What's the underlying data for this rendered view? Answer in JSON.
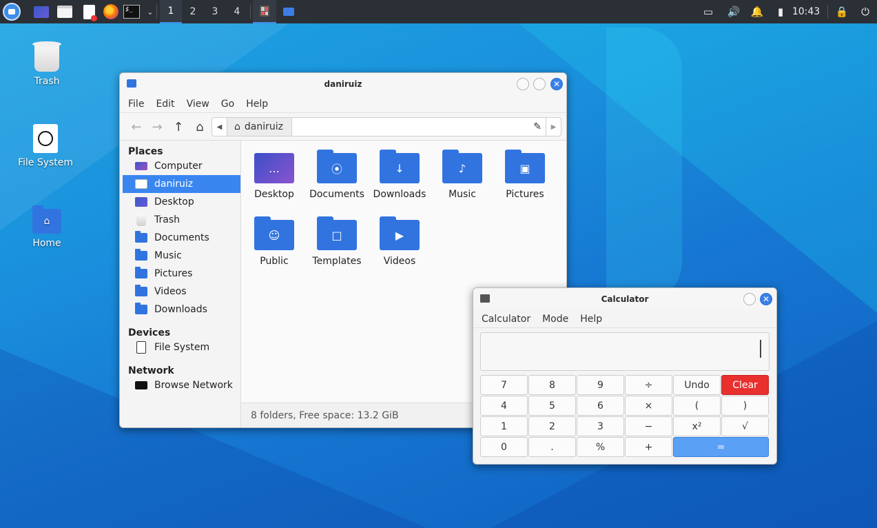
{
  "panel": {
    "workspaces": [
      "1",
      "2",
      "3",
      "4"
    ],
    "clock": "10:43",
    "term_prompt": "$_"
  },
  "desktop": {
    "icons": [
      "Trash",
      "File System",
      "Home"
    ]
  },
  "file_manager": {
    "title": "daniruiz",
    "menu": [
      "File",
      "Edit",
      "View",
      "Go",
      "Help"
    ],
    "path": "daniruiz",
    "sidebar": {
      "places_label": "Places",
      "places": [
        "Computer",
        "daniruiz",
        "Desktop",
        "Trash",
        "Documents",
        "Music",
        "Pictures",
        "Videos",
        "Downloads"
      ],
      "devices_label": "Devices",
      "devices": [
        "File System"
      ],
      "network_label": "Network",
      "network": [
        "Browse Network"
      ]
    },
    "files": [
      "Desktop",
      "Documents",
      "Downloads",
      "Music",
      "Pictures",
      "Public",
      "Templates",
      "Videos"
    ],
    "status": "8 folders, Free space: 13.2 GiB"
  },
  "calculator": {
    "title": "Calculator",
    "menu": [
      "Calculator",
      "Mode",
      "Help"
    ],
    "display": "",
    "keys": [
      "7",
      "8",
      "9",
      "÷",
      "Undo",
      "Clear",
      "4",
      "5",
      "6",
      "×",
      "(",
      ")",
      "1",
      "2",
      "3",
      "−",
      "x²",
      "√",
      "0",
      ".",
      "%",
      "+",
      "="
    ]
  },
  "colors": {
    "accent": "#3a86f0",
    "folder": "#3174e0",
    "clear": "#e8302f",
    "panel": "#2b2f36"
  }
}
